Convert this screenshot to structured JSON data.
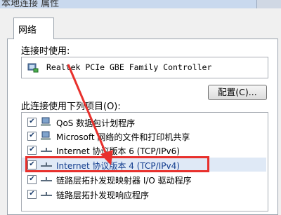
{
  "window": {
    "title": "本地连接 属性"
  },
  "tabs": [
    {
      "label": "网络"
    }
  ],
  "connect_using": {
    "label": "连接时使用:",
    "adapter": "Realtek PCIe GBE Family Controller",
    "configure_label": "配置(C)..."
  },
  "items_section": {
    "label": "此连接使用下列项目(O):",
    "items": [
      {
        "label": "QoS 数据包计划程序",
        "checked": true,
        "icon": "qos-icon"
      },
      {
        "label": "Microsoft 网络的文件和打印机共享",
        "checked": true,
        "icon": "file-share-icon"
      },
      {
        "label": "Internet 协议版本 6 (TCP/IPv6)",
        "checked": true,
        "icon": "protocol-icon"
      },
      {
        "label": "Internet 协议版本 4 (TCP/IPv4)",
        "checked": true,
        "icon": "protocol-icon",
        "selected": true
      },
      {
        "label": "链路层拓扑发现映射器 I/O 驱动程序",
        "checked": true,
        "icon": "protocol-icon"
      },
      {
        "label": "链路层拓扑发现响应程序",
        "checked": true,
        "icon": "protocol-icon"
      }
    ]
  },
  "colors": {
    "highlight": "#e8302c",
    "selection": "#dfe9f6"
  }
}
